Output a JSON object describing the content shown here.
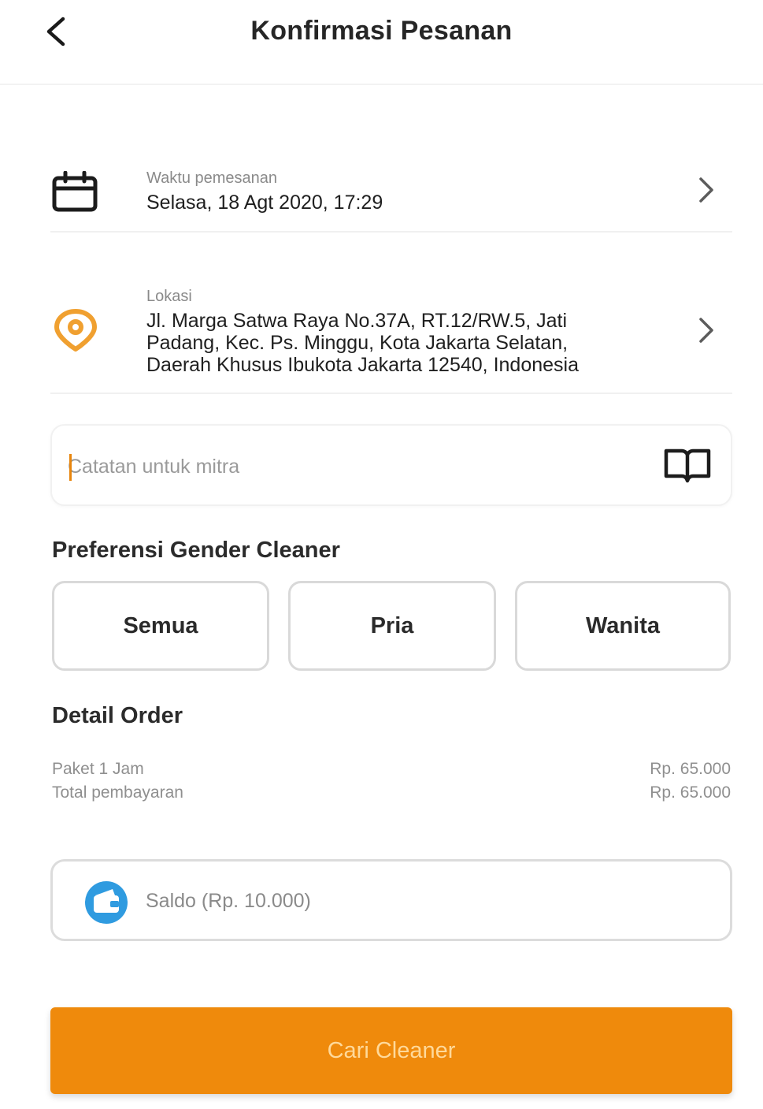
{
  "header": {
    "title": "Konfirmasi Pesanan",
    "back_icon": "chevron-left-icon"
  },
  "order_time": {
    "label": "Waktu pemesanan",
    "value": "Selasa, 18 Agt 2020, 17:29",
    "icon": "calendar-icon"
  },
  "location": {
    "label": "Lokasi",
    "lines": [
      "Jl. Marga Satwa Raya No.37A, RT.12/RW.5, Jati",
      "Padang, Kec. Ps. Minggu, Kota Jakarta Selatan,",
      "Daerah Khusus Ibukota Jakarta 12540, Indonesia"
    ],
    "icon": "location-pin-icon",
    "icon_color": "#f0a030"
  },
  "note": {
    "placeholder": "Catatan untuk mitra",
    "value": "",
    "icon": "book-icon"
  },
  "gender_preference": {
    "title": "Preferensi Gender Cleaner",
    "options": [
      "Semua",
      "Pria",
      "Wanita"
    ]
  },
  "detail_order": {
    "title": "Detail Order",
    "items": [
      {
        "label": "Paket 1 Jam",
        "amount": "Rp. 65.000"
      },
      {
        "label": "Total pembayaran",
        "amount": "Rp. 65.000"
      }
    ]
  },
  "balance": {
    "text": "Saldo (Rp. 10.000)",
    "icon": "wallet-icon",
    "icon_color": "#2f9be0"
  },
  "cta": {
    "label": "Cari Cleaner",
    "color": "#ef8a0c"
  }
}
